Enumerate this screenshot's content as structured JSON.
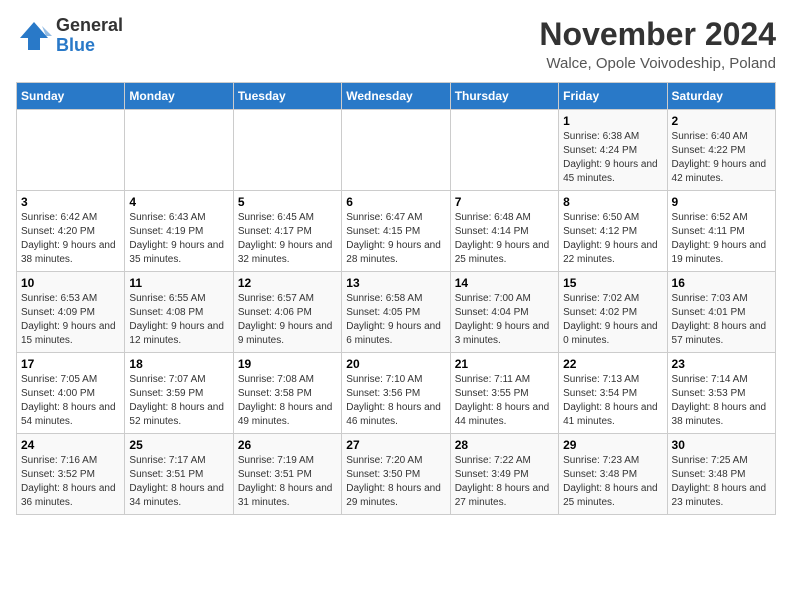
{
  "header": {
    "logo_general": "General",
    "logo_blue": "Blue",
    "month_title": "November 2024",
    "location": "Walce, Opole Voivodeship, Poland"
  },
  "columns": [
    "Sunday",
    "Monday",
    "Tuesday",
    "Wednesday",
    "Thursday",
    "Friday",
    "Saturday"
  ],
  "weeks": [
    [
      {
        "day": "",
        "sunrise": "",
        "sunset": "",
        "daylight": ""
      },
      {
        "day": "",
        "sunrise": "",
        "sunset": "",
        "daylight": ""
      },
      {
        "day": "",
        "sunrise": "",
        "sunset": "",
        "daylight": ""
      },
      {
        "day": "",
        "sunrise": "",
        "sunset": "",
        "daylight": ""
      },
      {
        "day": "",
        "sunrise": "",
        "sunset": "",
        "daylight": ""
      },
      {
        "day": "1",
        "sunrise": "Sunrise: 6:38 AM",
        "sunset": "Sunset: 4:24 PM",
        "daylight": "Daylight: 9 hours and 45 minutes."
      },
      {
        "day": "2",
        "sunrise": "Sunrise: 6:40 AM",
        "sunset": "Sunset: 4:22 PM",
        "daylight": "Daylight: 9 hours and 42 minutes."
      }
    ],
    [
      {
        "day": "3",
        "sunrise": "Sunrise: 6:42 AM",
        "sunset": "Sunset: 4:20 PM",
        "daylight": "Daylight: 9 hours and 38 minutes."
      },
      {
        "day": "4",
        "sunrise": "Sunrise: 6:43 AM",
        "sunset": "Sunset: 4:19 PM",
        "daylight": "Daylight: 9 hours and 35 minutes."
      },
      {
        "day": "5",
        "sunrise": "Sunrise: 6:45 AM",
        "sunset": "Sunset: 4:17 PM",
        "daylight": "Daylight: 9 hours and 32 minutes."
      },
      {
        "day": "6",
        "sunrise": "Sunrise: 6:47 AM",
        "sunset": "Sunset: 4:15 PM",
        "daylight": "Daylight: 9 hours and 28 minutes."
      },
      {
        "day": "7",
        "sunrise": "Sunrise: 6:48 AM",
        "sunset": "Sunset: 4:14 PM",
        "daylight": "Daylight: 9 hours and 25 minutes."
      },
      {
        "day": "8",
        "sunrise": "Sunrise: 6:50 AM",
        "sunset": "Sunset: 4:12 PM",
        "daylight": "Daylight: 9 hours and 22 minutes."
      },
      {
        "day": "9",
        "sunrise": "Sunrise: 6:52 AM",
        "sunset": "Sunset: 4:11 PM",
        "daylight": "Daylight: 9 hours and 19 minutes."
      }
    ],
    [
      {
        "day": "10",
        "sunrise": "Sunrise: 6:53 AM",
        "sunset": "Sunset: 4:09 PM",
        "daylight": "Daylight: 9 hours and 15 minutes."
      },
      {
        "day": "11",
        "sunrise": "Sunrise: 6:55 AM",
        "sunset": "Sunset: 4:08 PM",
        "daylight": "Daylight: 9 hours and 12 minutes."
      },
      {
        "day": "12",
        "sunrise": "Sunrise: 6:57 AM",
        "sunset": "Sunset: 4:06 PM",
        "daylight": "Daylight: 9 hours and 9 minutes."
      },
      {
        "day": "13",
        "sunrise": "Sunrise: 6:58 AM",
        "sunset": "Sunset: 4:05 PM",
        "daylight": "Daylight: 9 hours and 6 minutes."
      },
      {
        "day": "14",
        "sunrise": "Sunrise: 7:00 AM",
        "sunset": "Sunset: 4:04 PM",
        "daylight": "Daylight: 9 hours and 3 minutes."
      },
      {
        "day": "15",
        "sunrise": "Sunrise: 7:02 AM",
        "sunset": "Sunset: 4:02 PM",
        "daylight": "Daylight: 9 hours and 0 minutes."
      },
      {
        "day": "16",
        "sunrise": "Sunrise: 7:03 AM",
        "sunset": "Sunset: 4:01 PM",
        "daylight": "Daylight: 8 hours and 57 minutes."
      }
    ],
    [
      {
        "day": "17",
        "sunrise": "Sunrise: 7:05 AM",
        "sunset": "Sunset: 4:00 PM",
        "daylight": "Daylight: 8 hours and 54 minutes."
      },
      {
        "day": "18",
        "sunrise": "Sunrise: 7:07 AM",
        "sunset": "Sunset: 3:59 PM",
        "daylight": "Daylight: 8 hours and 52 minutes."
      },
      {
        "day": "19",
        "sunrise": "Sunrise: 7:08 AM",
        "sunset": "Sunset: 3:58 PM",
        "daylight": "Daylight: 8 hours and 49 minutes."
      },
      {
        "day": "20",
        "sunrise": "Sunrise: 7:10 AM",
        "sunset": "Sunset: 3:56 PM",
        "daylight": "Daylight: 8 hours and 46 minutes."
      },
      {
        "day": "21",
        "sunrise": "Sunrise: 7:11 AM",
        "sunset": "Sunset: 3:55 PM",
        "daylight": "Daylight: 8 hours and 44 minutes."
      },
      {
        "day": "22",
        "sunrise": "Sunrise: 7:13 AM",
        "sunset": "Sunset: 3:54 PM",
        "daylight": "Daylight: 8 hours and 41 minutes."
      },
      {
        "day": "23",
        "sunrise": "Sunrise: 7:14 AM",
        "sunset": "Sunset: 3:53 PM",
        "daylight": "Daylight: 8 hours and 38 minutes."
      }
    ],
    [
      {
        "day": "24",
        "sunrise": "Sunrise: 7:16 AM",
        "sunset": "Sunset: 3:52 PM",
        "daylight": "Daylight: 8 hours and 36 minutes."
      },
      {
        "day": "25",
        "sunrise": "Sunrise: 7:17 AM",
        "sunset": "Sunset: 3:51 PM",
        "daylight": "Daylight: 8 hours and 34 minutes."
      },
      {
        "day": "26",
        "sunrise": "Sunrise: 7:19 AM",
        "sunset": "Sunset: 3:51 PM",
        "daylight": "Daylight: 8 hours and 31 minutes."
      },
      {
        "day": "27",
        "sunrise": "Sunrise: 7:20 AM",
        "sunset": "Sunset: 3:50 PM",
        "daylight": "Daylight: 8 hours and 29 minutes."
      },
      {
        "day": "28",
        "sunrise": "Sunrise: 7:22 AM",
        "sunset": "Sunset: 3:49 PM",
        "daylight": "Daylight: 8 hours and 27 minutes."
      },
      {
        "day": "29",
        "sunrise": "Sunrise: 7:23 AM",
        "sunset": "Sunset: 3:48 PM",
        "daylight": "Daylight: 8 hours and 25 minutes."
      },
      {
        "day": "30",
        "sunrise": "Sunrise: 7:25 AM",
        "sunset": "Sunset: 3:48 PM",
        "daylight": "Daylight: 8 hours and 23 minutes."
      }
    ]
  ]
}
